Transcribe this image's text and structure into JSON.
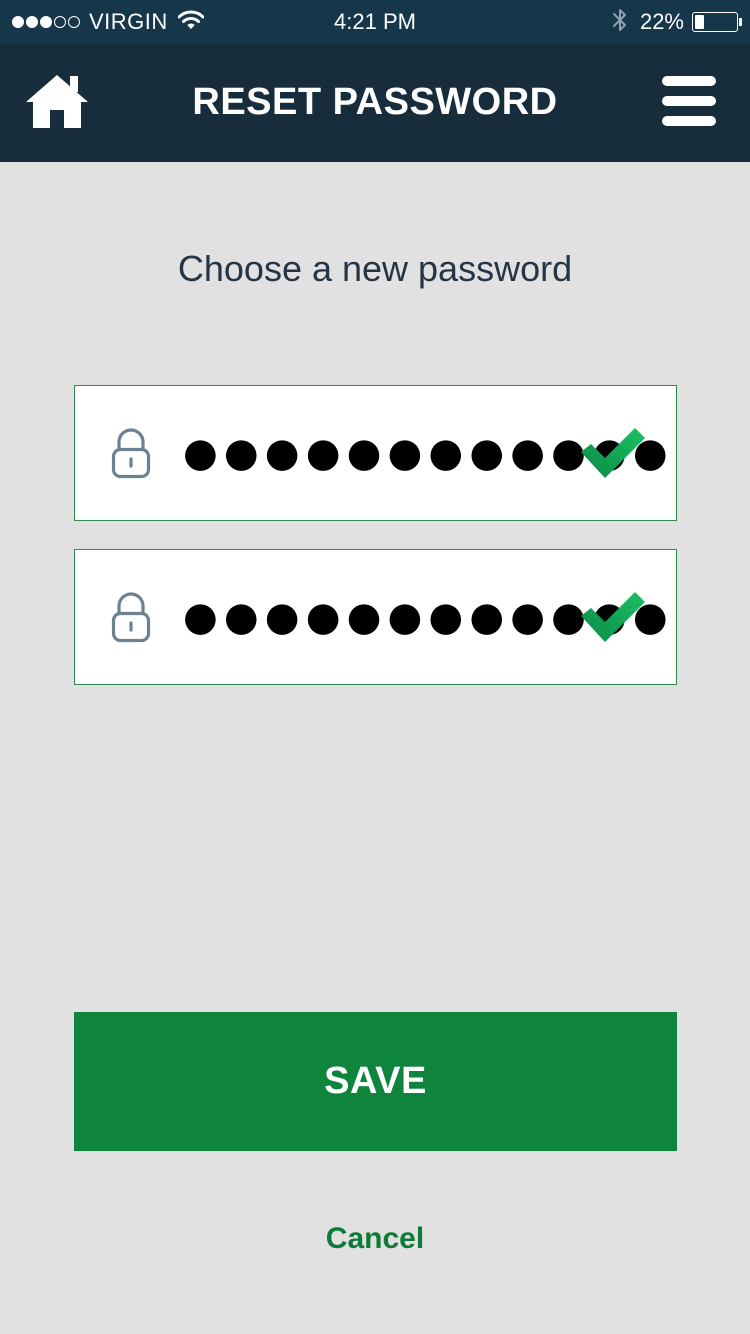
{
  "status_bar": {
    "signal_full": 3,
    "signal_total": 5,
    "carrier": "VIRGIN",
    "wifi_icon": "wifi-icon",
    "time": "4:21 PM",
    "bluetooth_icon": "bluetooth-icon",
    "battery_percent": "22%",
    "battery_level": 0.22
  },
  "nav": {
    "home_icon": "home-icon",
    "title": "RESET PASSWORD",
    "menu_icon": "hamburger-menu-icon"
  },
  "form": {
    "prompt": "Choose a new password",
    "new_password": {
      "value": "●●●●●●●●●●●●",
      "icon": "lock-icon",
      "valid": true,
      "status_icon": "checkmark-icon"
    },
    "confirm_password": {
      "value": "●●●●●●●●●●●●",
      "icon": "lock-icon",
      "valid": true,
      "status_icon": "checkmark-icon"
    }
  },
  "actions": {
    "save_label": "SAVE",
    "cancel_label": "Cancel"
  },
  "colors": {
    "status_bar_bg": "#16364a",
    "nav_bg": "#182d3c",
    "page_bg": "#e1e1e1",
    "accent_green": "#0e843c",
    "check_green": "#16b356",
    "prompt_text": "#253545"
  }
}
